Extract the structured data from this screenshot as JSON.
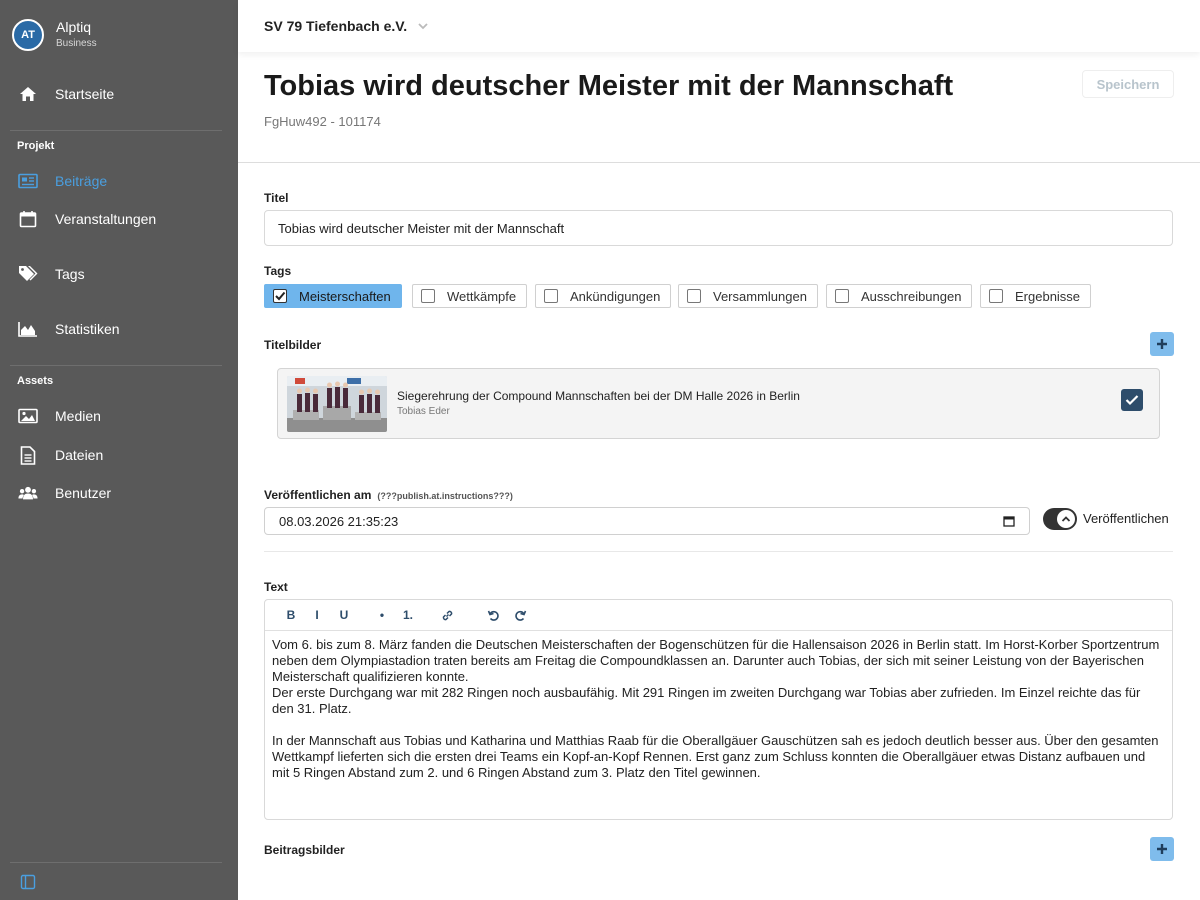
{
  "brand": {
    "logo_text": "AT",
    "name": "Alptiq",
    "subtitle": "Business"
  },
  "sidebar": {
    "home": "Startseite",
    "section_project": "Projekt",
    "project_items": [
      {
        "label": "Beiträge",
        "icon": "newspaper-icon",
        "active": true
      },
      {
        "label": "Veranstaltungen",
        "icon": "calendar-icon",
        "active": false
      },
      {
        "label": "Tags",
        "icon": "tags-icon",
        "active": false
      },
      {
        "label": "Statistiken",
        "icon": "area-chart-icon",
        "active": false
      }
    ],
    "section_assets": "Assets",
    "asset_items": [
      {
        "label": "Medien",
        "icon": "image-icon"
      },
      {
        "label": "Dateien",
        "icon": "file-icon"
      },
      {
        "label": "Benutzer",
        "icon": "users-icon"
      }
    ]
  },
  "topbar": {
    "organization": "SV 79 Tiefenbach e.V."
  },
  "header": {
    "title": "Tobias wird deutscher Meister mit der Mannschaft",
    "subtitle": "FgHuw492 - 101174",
    "save_label": "Speichern"
  },
  "form": {
    "title_label": "Titel",
    "title_value": "Tobias wird deutscher Meister mit der Mannschaft",
    "tags_label": "Tags",
    "tags": [
      {
        "label": "Meisterschaften",
        "checked": true
      },
      {
        "label": "Wettkämpfe",
        "checked": false
      },
      {
        "label": "Ankündigungen",
        "checked": false
      },
      {
        "label": "Versammlungen",
        "checked": false
      },
      {
        "label": "Ausschreibungen",
        "checked": false
      },
      {
        "label": "Ergebnisse",
        "checked": false
      }
    ],
    "title_images_label": "Titelbilder",
    "title_image": {
      "caption": "Siegerehrung der Compound Mannschaften bei der DM Halle 2026 in Berlin",
      "author": "Tobias Eder",
      "selected": true
    },
    "publish_label": "Veröffentlichen am",
    "publish_hint": "(???publish.at.instructions???)",
    "publish_value": "08.03.2026 21:35:23",
    "publish_toggle_label": "Veröffentlichen",
    "publish_toggle_on": true,
    "text_label": "Text",
    "toolbar": {
      "bold": "B",
      "italic": "I",
      "underline": "U",
      "bullet": "•",
      "ordered": "1."
    },
    "text_paragraphs": [
      "Vom 6. bis zum 8. März fanden die Deutschen Meisterschaften der Bogenschützen für die Hallensaison 2026 in Berlin statt. Im Horst-Korber Sportzentrum neben dem Olympiastadion traten bereits am Freitag die Compoundklassen an. Darunter auch Tobias, der sich mit seiner Leistung von der Bayerischen Meisterschaft qualifizieren konnte.",
      "Der erste Durchgang war mit 282 Ringen noch ausbaufähig. Mit 291 Ringen im zweiten Durchgang war Tobias aber zufrieden. Im Einzel reichte das für den 31. Platz.",
      "In der Mannschaft aus Tobias und Katharina und Matthias Raab für die Oberallgäuer Gauschützen sah es jedoch deutlich besser aus. Über den gesamten Wettkampf lieferten sich die ersten drei Teams ein Kopf-an-Kopf Rennen. Erst ganz zum Schluss konnten die Oberallgäuer etwas Distanz aufbauen und mit 5 Ringen Abstand zum 2. und 6 Ringen Abstand zum 3. Platz den Titel gewinnen."
    ],
    "post_images_label": "Beitragsbilder"
  },
  "colors": {
    "sidebar": "#595959",
    "active": "#4a9fe0",
    "accent": "#6fb5ec",
    "dark_accent": "#2e4d6b"
  }
}
